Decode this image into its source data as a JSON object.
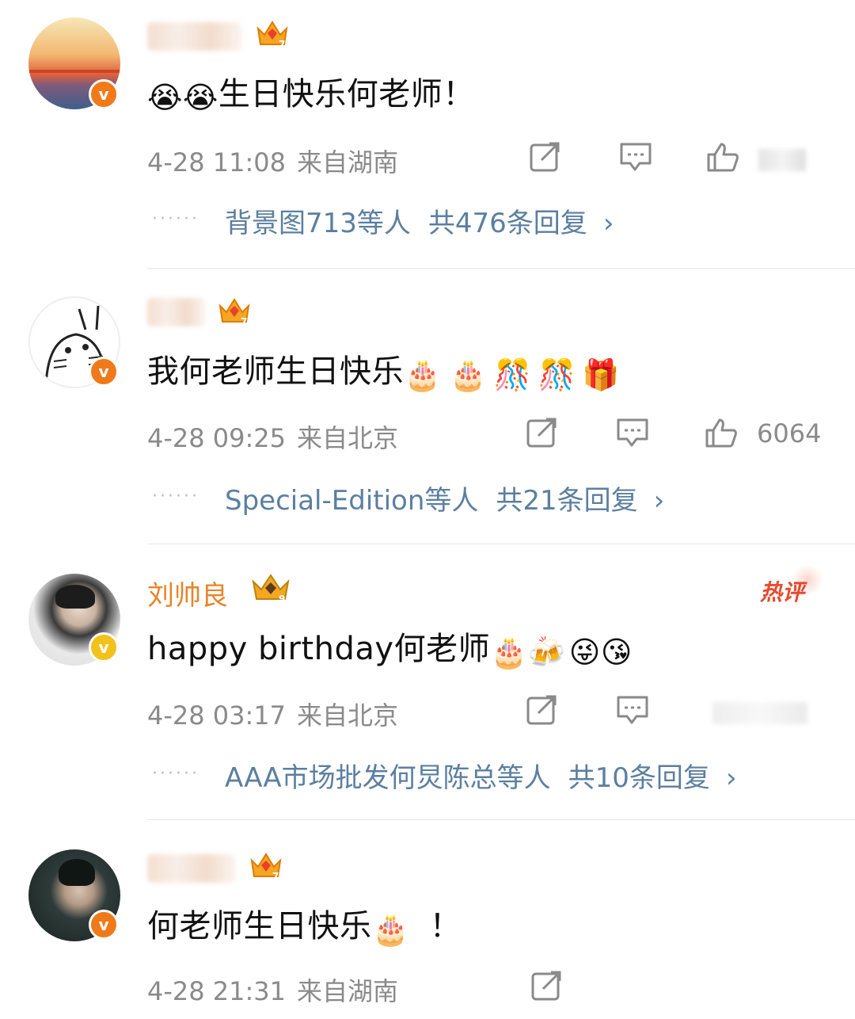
{
  "comments": [
    {
      "content": "生日快乐何老师！",
      "content_emojis": [
        "😭",
        "😭"
      ],
      "time": "4-28 11:08",
      "location": "来自湖南",
      "replies_by": "背景图713等人",
      "replies_total": "共476条回复",
      "verified_badge": "orange"
    },
    {
      "content": "我何老师生日快乐",
      "trail_emojis": [
        "🎂",
        "🎂",
        "🎊",
        "🎊",
        "🎁"
      ],
      "time": "4-28 09:25",
      "location": "来自北京",
      "like_count": "6064",
      "replies_by": "Special-Edition等人",
      "replies_total": "共21条回复",
      "verified_badge": "orange"
    },
    {
      "name": "刘帅良",
      "hot_label": "热评",
      "content": "happy birthday何老师",
      "trail_emojis": [
        "🎂",
        "🍻",
        "😜",
        "😘"
      ],
      "time": "4-28 03:17",
      "location": "来自北京",
      "replies_by": "AAA市场批发何炅陈总等人",
      "replies_total": "共10条回复",
      "verified_badge": "gold"
    },
    {
      "content": "何老师生日快乐",
      "trail_emojis": [
        "🎂"
      ],
      "trail_text": " ！",
      "time": "4-28 21:31",
      "location": "来自湖南",
      "verified_badge": "orange"
    }
  ],
  "icons": {
    "repost": "repost-icon",
    "comment": "comment-icon",
    "like": "like-icon",
    "chevron": "chevron-right-icon",
    "crown": "crown-icon",
    "verified": "verified-v-icon"
  },
  "chevron_glyph": "›",
  "colors": {
    "reply_link": "#5b7fa0",
    "meta_gray": "#8a8a8a",
    "name_orange": "#e8852a",
    "hot_red": "#e8492f",
    "badge_orange": "#f07a1a",
    "badge_gold": "#f2c21b"
  }
}
